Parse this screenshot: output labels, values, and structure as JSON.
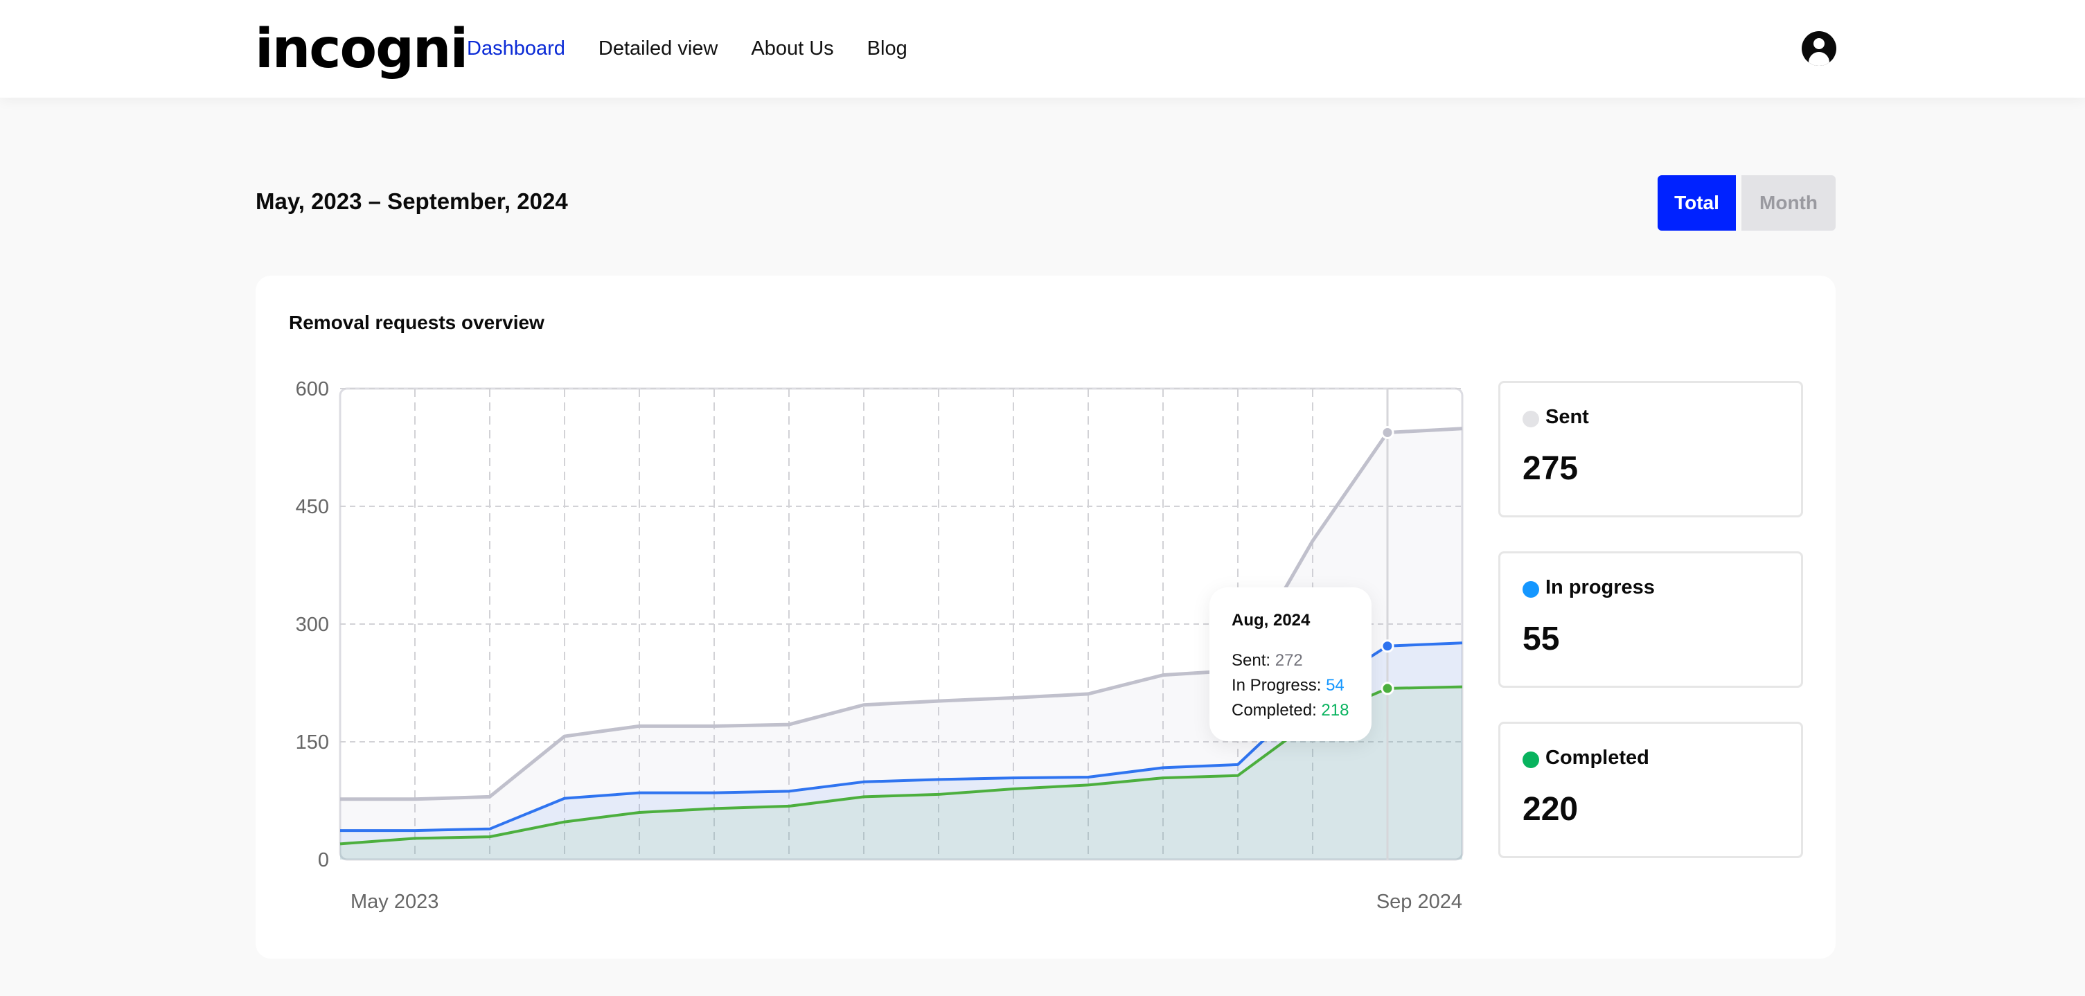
{
  "header": {
    "logo": "incogni",
    "nav": [
      {
        "label": "Dashboard",
        "active": true
      },
      {
        "label": "Detailed view",
        "active": false
      },
      {
        "label": "About Us",
        "active": false
      },
      {
        "label": "Blog",
        "active": false
      }
    ],
    "account_icon": "user-circle-icon"
  },
  "range": {
    "title": "May, 2023 – September, 2024",
    "toggle": {
      "total": "Total",
      "month": "Month",
      "selected": "Total"
    }
  },
  "colors": {
    "accent": "#0022ff",
    "nav_active": "#0a2ad6",
    "sent": "#c0c0cc",
    "in_progress": "#2f74f0",
    "completed": "#4caf3e",
    "sent_dot": "#e3e3e6",
    "in_progress_dot": "#1597ff",
    "completed_dot": "#08b35e"
  },
  "card": {
    "title": "Removal requests overview"
  },
  "tooltip": {
    "title": "Aug, 2024",
    "rows": [
      {
        "label": "Sent: ",
        "value": "272",
        "color": "#74747c"
      },
      {
        "label": "In Progress: ",
        "value": "54",
        "color": "#1597ff"
      },
      {
        "label": "Completed: ",
        "value": "218",
        "color": "#08b35e"
      }
    ]
  },
  "stats": [
    {
      "label": "Sent",
      "value": "275",
      "dot": "#e3e3e6"
    },
    {
      "label": "In progress",
      "value": "55",
      "dot": "#1597ff"
    },
    {
      "label": "Completed",
      "value": "220",
      "dot": "#08b35e"
    }
  ],
  "chart_data": {
    "type": "area",
    "stacked": true,
    "title": "Removal requests overview",
    "xlabel": "",
    "ylabel": "",
    "x_tick_labels": [
      "May 2023",
      "Sep 2024"
    ],
    "y_ticks": [
      0,
      150,
      300,
      450,
      600
    ],
    "ylim": [
      0,
      600
    ],
    "grid": true,
    "highlighted_index": 14,
    "highlighted_label": "Aug, 2024",
    "points": 16,
    "series": [
      {
        "name": "Completed",
        "values": [
          20,
          27,
          29,
          48,
          60,
          65,
          68,
          80,
          83,
          90,
          95,
          104,
          107,
          177,
          218,
          220
        ]
      },
      {
        "name": "In Progress",
        "values": [
          17,
          10,
          10,
          30,
          25,
          20,
          19,
          19,
          19,
          14,
          10,
          13,
          14,
          34,
          54,
          56
        ]
      },
      {
        "name": "Sent",
        "values": [
          40,
          40,
          41,
          79,
          85,
          85,
          85,
          98,
          100,
          102,
          106,
          118,
          120,
          195,
          272,
          273
        ]
      }
    ]
  }
}
